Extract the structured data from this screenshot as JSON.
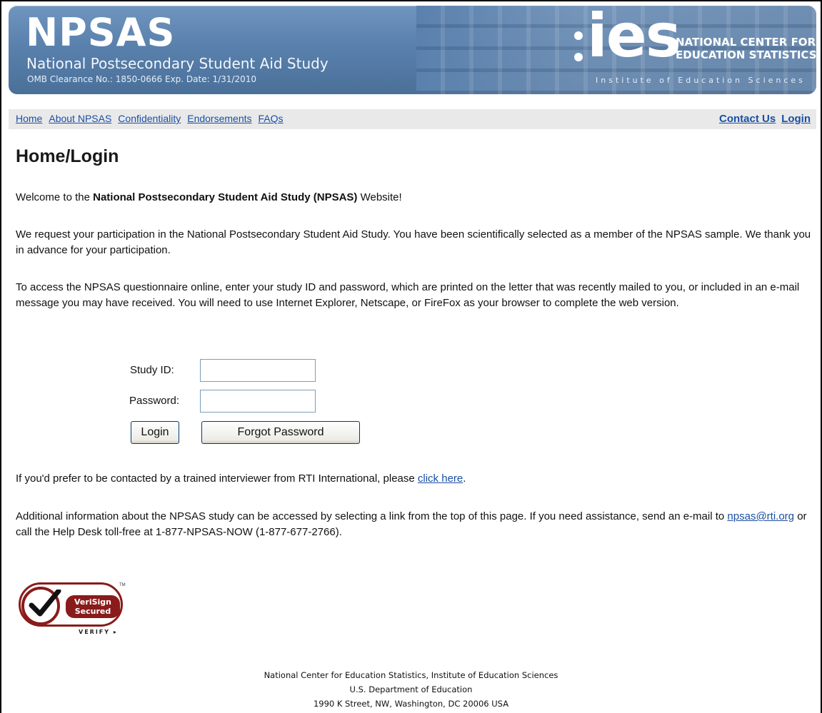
{
  "header": {
    "title": "NPSAS",
    "subtitle": "National Postsecondary Student Aid Study",
    "omb": "OMB Clearance No.: 1850-0666   Exp. Date: 1/31/2010",
    "ies_word": "ies",
    "nces_line1": "NATIONAL CENTER FOR",
    "nces_line2": "EDUCATION STATISTICS",
    "institute": "Institute of Education Sciences"
  },
  "nav": {
    "left": [
      "Home",
      "About NPSAS",
      "Confidentiality",
      "Endorsements",
      "FAQs"
    ],
    "right": [
      "Contact Us",
      "Login"
    ]
  },
  "page": {
    "title": "Home/Login",
    "welcome_pre": "Welcome to the ",
    "welcome_bold": "National Postsecondary Student Aid Study (NPSAS)",
    "welcome_post": " Website!",
    "request": "We request your participation in the National Postsecondary Student Aid Study. You have been scientifically selected as a member of the NPSAS sample. We thank you in advance for your participation.",
    "access": "To access the NPSAS questionnaire online, enter your study ID and password, which are printed on the letter that was recently mailed to you, or included in an e-mail message you may have received. You will need to use Internet Explorer, Netscape, or FireFox as your browser to complete the web version."
  },
  "form": {
    "study_id_label": "Study ID:",
    "study_id_value": "",
    "password_label": "Password:",
    "password_value": "",
    "login_button": "Login",
    "forgot_button": "Forgot Password"
  },
  "contact": {
    "pre": "If you'd prefer to be contacted by a trained interviewer from RTI International, please ",
    "link": "click here",
    "post": "."
  },
  "info": {
    "pre": "Additional information about the NPSAS study can be accessed by selecting a link from the top of this page.  If you need assistance, send an e-mail to ",
    "email": "npsas@rti.org",
    "post": " or call the Help Desk toll-free at 1-877-NPSAS-NOW (1-877-677-2766)."
  },
  "verisign": {
    "line1": "VeriSign",
    "line2": "Secured",
    "verify": "VERIFY ▸",
    "tm": "TM",
    "icon": "checkmark-seal-icon",
    "color": "#8a1b1b"
  },
  "footer": {
    "line1": "National Center for Education Statistics, Institute of Education Sciences",
    "line2": "U.S. Department of Education",
    "line3": "1990 K Street, NW, Washington, DC 20006 USA"
  },
  "colors": {
    "banner": "#5a81ad",
    "link": "#1a4fa3",
    "nav_bg": "#e9e9e9"
  }
}
